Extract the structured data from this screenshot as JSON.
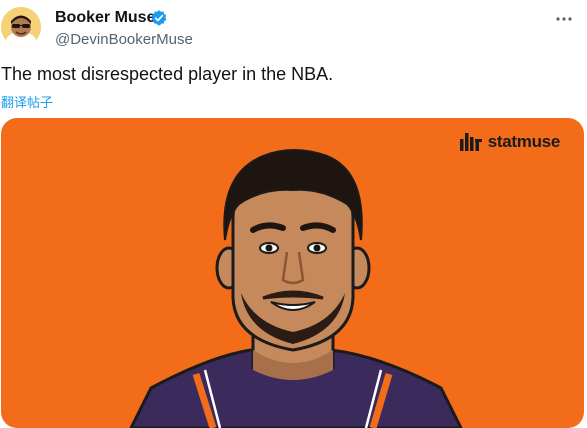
{
  "author": {
    "name": "Booker Muse",
    "handle": "@DevinBookerMuse",
    "verified": true,
    "verified_color": "#1d9bf0",
    "avatar_icon": "cartoon-avatar-sunglasses"
  },
  "menu": {
    "icon": "more-icon"
  },
  "tweet": {
    "text": "The most disrespected player in the NBA.",
    "translate_label": "翻译帖子"
  },
  "media": {
    "background_color": "#f36c1a",
    "brand": "statmuse",
    "brand_icon": "statmuse-logo-icon"
  },
  "colors": {
    "text": "#0f1419",
    "secondary": "#536471",
    "link": "#1d9bf0",
    "jersey": "#3b2a5c"
  }
}
